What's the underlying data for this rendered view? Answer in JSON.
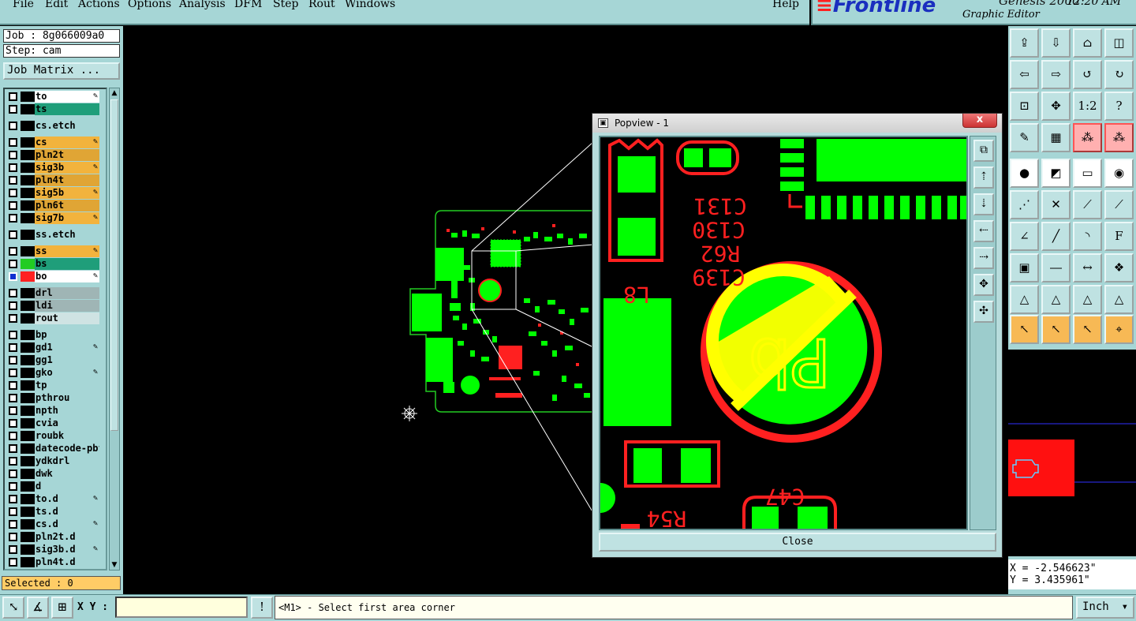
{
  "menubar": {
    "items": [
      "File",
      "Edit",
      "Actions",
      "Options",
      "Analysis",
      "DFM",
      "Step",
      "Rout",
      "Windows"
    ],
    "help": "Help"
  },
  "brand": {
    "logo": "Frontline",
    "product": "Genesis 2000",
    "subtitle": "Graphic Editor",
    "clock": "12:20 AM"
  },
  "job": {
    "job_line": "Job : 8g066009a0",
    "step_line": "Step: cam",
    "matrix_button": "Job Matrix ..."
  },
  "layers": [
    {
      "name": "to",
      "color": "#ffffff",
      "swatch": "#000000",
      "pen": true
    },
    {
      "name": "ts",
      "color": "#1f9e7a",
      "swatch": "#000000",
      "pen": false
    },
    {
      "name": "cs.etch",
      "color": "#a6d6d6",
      "swatch": "#000000",
      "pen": false
    },
    {
      "name": "cs",
      "color": "#f2b33d",
      "swatch": "#000000",
      "pen": true
    },
    {
      "name": "pln2t",
      "color": "#e0a535",
      "swatch": "#000000",
      "pen": false
    },
    {
      "name": "sig3b",
      "color": "#f2b33d",
      "swatch": "#000000",
      "pen": true
    },
    {
      "name": "pln4t",
      "color": "#e0a535",
      "swatch": "#000000",
      "pen": false
    },
    {
      "name": "sig5b",
      "color": "#f2b33d",
      "swatch": "#000000",
      "pen": true
    },
    {
      "name": "pln6t",
      "color": "#e0a535",
      "swatch": "#000000",
      "pen": false
    },
    {
      "name": "sig7b",
      "color": "#f2b33d",
      "swatch": "#000000",
      "pen": true
    },
    {
      "name": "ss.etch",
      "color": "#a6d6d6",
      "swatch": "#000000",
      "pen": false
    },
    {
      "name": "ss",
      "color": "#f2b33d",
      "swatch": "#000000",
      "pen": true
    },
    {
      "name": "bs",
      "color": "#1f9e7a",
      "swatch": "#22cc22",
      "pen": false
    },
    {
      "name": "bo",
      "color": "#ffffff",
      "swatch": "#ff2222",
      "pen": true
    },
    {
      "name": "drl",
      "color": "#9fb5b5",
      "swatch": "#000000",
      "pen": false
    },
    {
      "name": "ldi",
      "color": "#9fb5b5",
      "swatch": "#000000",
      "pen": false
    },
    {
      "name": "rout",
      "color": "#cfe3e3",
      "swatch": "#000000",
      "pen": false
    },
    {
      "name": "bp",
      "color": "#a6d6d6",
      "swatch": "#000000",
      "pen": false
    },
    {
      "name": "gd1",
      "color": "#a6d6d6",
      "swatch": "#000000",
      "pen": true
    },
    {
      "name": "gg1",
      "color": "#a6d6d6",
      "swatch": "#000000",
      "pen": false
    },
    {
      "name": "gko",
      "color": "#a6d6d6",
      "swatch": "#000000",
      "pen": true
    },
    {
      "name": "tp",
      "color": "#a6d6d6",
      "swatch": "#000000",
      "pen": false
    },
    {
      "name": "pthrou",
      "color": "#a6d6d6",
      "swatch": "#000000",
      "pen": false
    },
    {
      "name": "npth",
      "color": "#a6d6d6",
      "swatch": "#000000",
      "pen": false
    },
    {
      "name": "cvia",
      "color": "#a6d6d6",
      "swatch": "#000000",
      "pen": false
    },
    {
      "name": "roubk",
      "color": "#a6d6d6",
      "swatch": "#000000",
      "pen": false
    },
    {
      "name": "datecode-pbf",
      "color": "#a6d6d6",
      "swatch": "#000000",
      "pen": false
    },
    {
      "name": "ydkdrl",
      "color": "#a6d6d6",
      "swatch": "#000000",
      "pen": false
    },
    {
      "name": "dwk",
      "color": "#a6d6d6",
      "swatch": "#000000",
      "pen": false
    },
    {
      "name": "d",
      "color": "#a6d6d6",
      "swatch": "#000000",
      "pen": false
    },
    {
      "name": "to.d",
      "color": "#a6d6d6",
      "swatch": "#000000",
      "pen": true
    },
    {
      "name": "ts.d",
      "color": "#a6d6d6",
      "swatch": "#000000",
      "pen": false
    },
    {
      "name": "cs.d",
      "color": "#a6d6d6",
      "swatch": "#000000",
      "pen": true
    },
    {
      "name": "pln2t.d",
      "color": "#a6d6d6",
      "swatch": "#000000",
      "pen": false
    },
    {
      "name": "sig3b.d",
      "color": "#a6d6d6",
      "swatch": "#000000",
      "pen": true
    },
    {
      "name": "pln4t.d",
      "color": "#a6d6d6",
      "swatch": "#000000",
      "pen": false
    }
  ],
  "selected": "Selected : 0",
  "popview": {
    "title": "Popview - 1",
    "close_x": "x",
    "close_button": "Close",
    "silk_labels": [
      "C131",
      "C130",
      "R62",
      "C139",
      "L8",
      "R54",
      "C47"
    ],
    "pb_mark": "Pb"
  },
  "coords": {
    "x": "X = -2.546623\"",
    "y": "Y = 3.435961\""
  },
  "status": {
    "xy_label": "X Y :",
    "xy_value": "",
    "prompt": "<M1> - Select first area corner",
    "units": "Inch"
  },
  "colors": {
    "panel": "#a6d6d6",
    "copper_green": "#00ff00",
    "silk_red": "#ff2020",
    "highlight_yellow": "#ffff00"
  }
}
